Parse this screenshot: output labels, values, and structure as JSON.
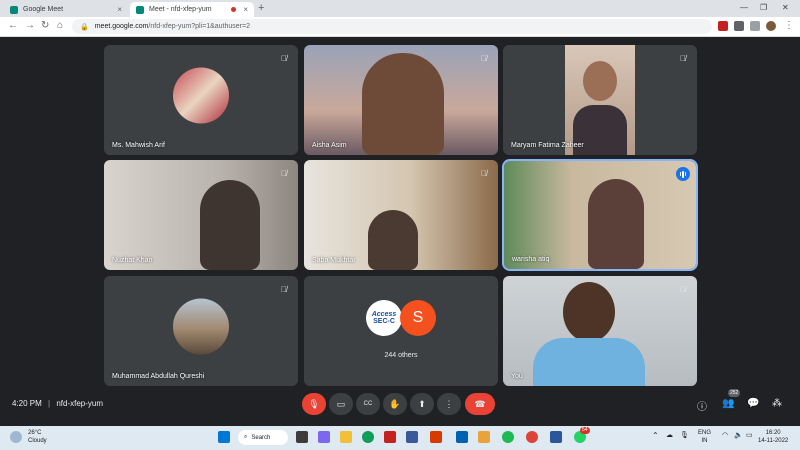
{
  "browser": {
    "tabs": [
      {
        "title": "Google Meet",
        "active": false
      },
      {
        "title": "Meet - nfd-xfep-yum",
        "active": true
      }
    ],
    "url_host": "meet.google.com",
    "url_path": "/nfd-xfep-yum?pli=1&authuser=2"
  },
  "tiles": [
    {
      "name": "Ms. Mahwish Arif",
      "muted": true
    },
    {
      "name": "Aisha Asim",
      "muted": true
    },
    {
      "name": "Maryam Fatima Zaheer",
      "muted": true
    },
    {
      "name": "Nuzhat Khan",
      "muted": true
    },
    {
      "name": "Saba Mukhtar",
      "muted": true
    },
    {
      "name": "warisha atiq",
      "muted": false
    },
    {
      "name": "Muhammad Abdullah Qureshi",
      "muted": true
    },
    {
      "name": "244 others",
      "muted": false
    },
    {
      "name": "You",
      "muted": true
    }
  ],
  "others_tile": {
    "logo_text_top": "Access",
    "logo_text_bottom": "SEC-C",
    "avatar_letter": "S"
  },
  "bottom_bar": {
    "time": "4:20 PM",
    "meeting_code": "nfd-xfep-yum",
    "participants_count": "252"
  },
  "taskbar": {
    "temperature": "26°C",
    "weather": "Cloudy",
    "search_label": "Search",
    "lang_top": "ENG",
    "lang_bottom": "IN",
    "clock_time": "16:20",
    "clock_date": "14-11-2022",
    "whatsapp_badge": "54"
  },
  "colors": {
    "meet_bg": "#202124",
    "tile_bg": "#3c4043",
    "red": "#ea4335",
    "active_border": "#8ab4f8"
  }
}
